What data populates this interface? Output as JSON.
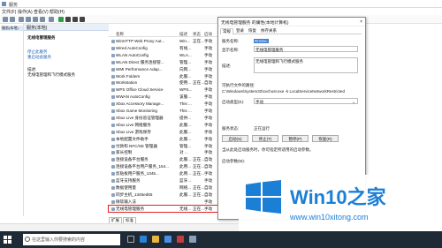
{
  "window": {
    "title": "服务"
  },
  "menu": [
    "文件(F)",
    "操作(A)",
    "查看(V)",
    "帮助(H)"
  ],
  "nav": {
    "item": "服务(本地)"
  },
  "services_header": "服务(本地)",
  "desc_panel": {
    "name": "无线电管理服务",
    "link1": "停止此服务",
    "link2": "重启动此服务",
    "desc_label": "描述:",
    "desc_text": "无线电管理和飞行模式服务"
  },
  "table": {
    "headers": [
      "名称",
      "描述",
      "状态",
      "启动"
    ],
    "rows": [
      {
        "name": "WinHTTP Web Proxy Aut...",
        "desc": "Win...",
        "status": "正在...",
        "start": "手动"
      },
      {
        "name": "Wired AutoConfig",
        "desc": "有线...",
        "status": "",
        "start": "手动"
      },
      {
        "name": "WLAN AutoConfig",
        "desc": "WLA...",
        "status": "",
        "start": "手动"
      },
      {
        "name": "WLAN Direct 服务连接管...",
        "desc": "管理...",
        "status": "",
        "start": "手动"
      },
      {
        "name": "WMI Performance Adap...",
        "desc": "向网...",
        "status": "",
        "start": "手动"
      },
      {
        "name": "Work Folders",
        "desc": "此服...",
        "status": "",
        "start": "手动"
      },
      {
        "name": "Workstation",
        "desc": "使用...",
        "status": "正在...",
        "start": "自动"
      },
      {
        "name": "WPS Office Cloud Service",
        "desc": "WPS...",
        "status": "",
        "start": "手动"
      },
      {
        "name": "WWAN AutoConfig",
        "desc": "该服...",
        "status": "",
        "start": "手动"
      },
      {
        "name": "Xbox Accessory Manage...",
        "desc": "This ...",
        "status": "",
        "start": "手动"
      },
      {
        "name": "Xbox Game Monitoring",
        "desc": "This ...",
        "status": "",
        "start": "手动"
      },
      {
        "name": "Xbox Live 身份验证管理器",
        "desc": "提供...",
        "status": "",
        "start": "手动"
      },
      {
        "name": "Xbox Live 网络服务",
        "desc": "此服...",
        "status": "",
        "start": "手动"
      },
      {
        "name": "Xbox Live 游戏保存",
        "desc": "此服...",
        "status": "",
        "start": "手动"
      },
      {
        "name": "本地配置文件助手",
        "desc": "此服...",
        "status": "",
        "start": "手动"
      },
      {
        "name": "付款和 NFC/SE 管理器",
        "desc": "管理...",
        "status": "",
        "start": "手动"
      },
      {
        "name": "家长控制",
        "desc": "对 ...",
        "status": "",
        "start": "手动"
      },
      {
        "name": "连接设备平台服务",
        "desc": "此服...",
        "status": "正在...",
        "start": "自动"
      },
      {
        "name": "连接设备平台用户服务_154...",
        "desc": "此用...",
        "status": "正在...",
        "start": "自动"
      },
      {
        "name": "剪贴板用户服务_1345...",
        "desc": "此用...",
        "status": "正在...",
        "start": "手动"
      },
      {
        "name": "蓝牙支持服务",
        "desc": "蓝牙...",
        "status": "",
        "start": "手动"
      },
      {
        "name": "数据使用量",
        "desc": "网络...",
        "status": "正在...",
        "start": "自动"
      },
      {
        "name": "同步主机_1345ed55",
        "desc": "此服...",
        "status": "正在...",
        "start": "自动"
      },
      {
        "name": "微软输入法",
        "desc": "",
        "status": "",
        "start": "手动"
      },
      {
        "name": "无线电管理服务",
        "desc": "无线...",
        "status": "正在...",
        "start": "手动"
      }
    ]
  },
  "tabs": [
    "扩展",
    "标准"
  ],
  "dialog": {
    "title": "无线电管理服务 的属性(本地计算机)",
    "close": "×",
    "tabs": [
      "常规",
      "登录",
      "恢复",
      "依存关系"
    ],
    "service_name_label": "服务名称:",
    "service_name": "RmSvc",
    "display_name_label": "显示名称:",
    "display_name": "无线电管理服务",
    "desc_label": "描述:",
    "desc": "无线电管理和飞行模式服务",
    "exe_label": "可执行文件的路径:",
    "exe_path": "C:\\Windows\\System32\\svchost.exe -k LocalServiceNetworkRestricted",
    "startup_label": "启动类型(E):",
    "startup_value": "手动",
    "status_label": "服务状态:",
    "status_value": "正在运行",
    "btn_start": "启动(S)",
    "btn_stop": "停止(T)",
    "btn_pause": "暂停(P)",
    "btn_resume": "恢复(R)",
    "hint": "当从此处启动服务时，你可指定所适用的启动参数。",
    "param_label": "启动参数(M):"
  },
  "taskbar": {
    "search_placeholder": "在这里输入你要搜索的内容"
  },
  "watermark": {
    "brand": "Win10之家",
    "url": "www.win10xitong.com"
  },
  "colors": {
    "accent": "#1b7fd6",
    "taskbar": "#1f2a37",
    "highlight": "#e02020"
  }
}
